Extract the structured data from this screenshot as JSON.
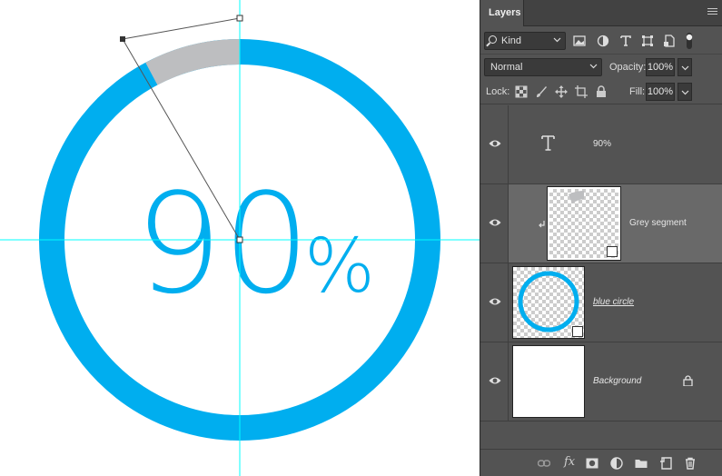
{
  "canvas": {
    "percent_number": "90",
    "percent_sign": "%",
    "colors": {
      "ring": "#00AEEF",
      "segment": "#BDBEC0",
      "guide": "#00FFFF",
      "number": "#00AEEF"
    }
  },
  "panel": {
    "tab_label": "Layers",
    "filter": {
      "kind_label": "Kind"
    },
    "blend_mode": "Normal",
    "opacity_label": "Opacity:",
    "opacity_value": "100%",
    "lock_label": "Lock:",
    "fill_label": "Fill:",
    "fill_value": "100%",
    "layers": [
      {
        "name": "90%",
        "type": "text",
        "visible": true
      },
      {
        "name": "Grey segment",
        "type": "smart-object",
        "visible": true,
        "selected": true,
        "clipped": true
      },
      {
        "name": "blue circle",
        "type": "smart-object",
        "visible": true
      },
      {
        "name": "Background",
        "type": "background",
        "visible": true,
        "locked": true
      }
    ],
    "bottom_bar": {
      "fx_label": "fx"
    }
  }
}
